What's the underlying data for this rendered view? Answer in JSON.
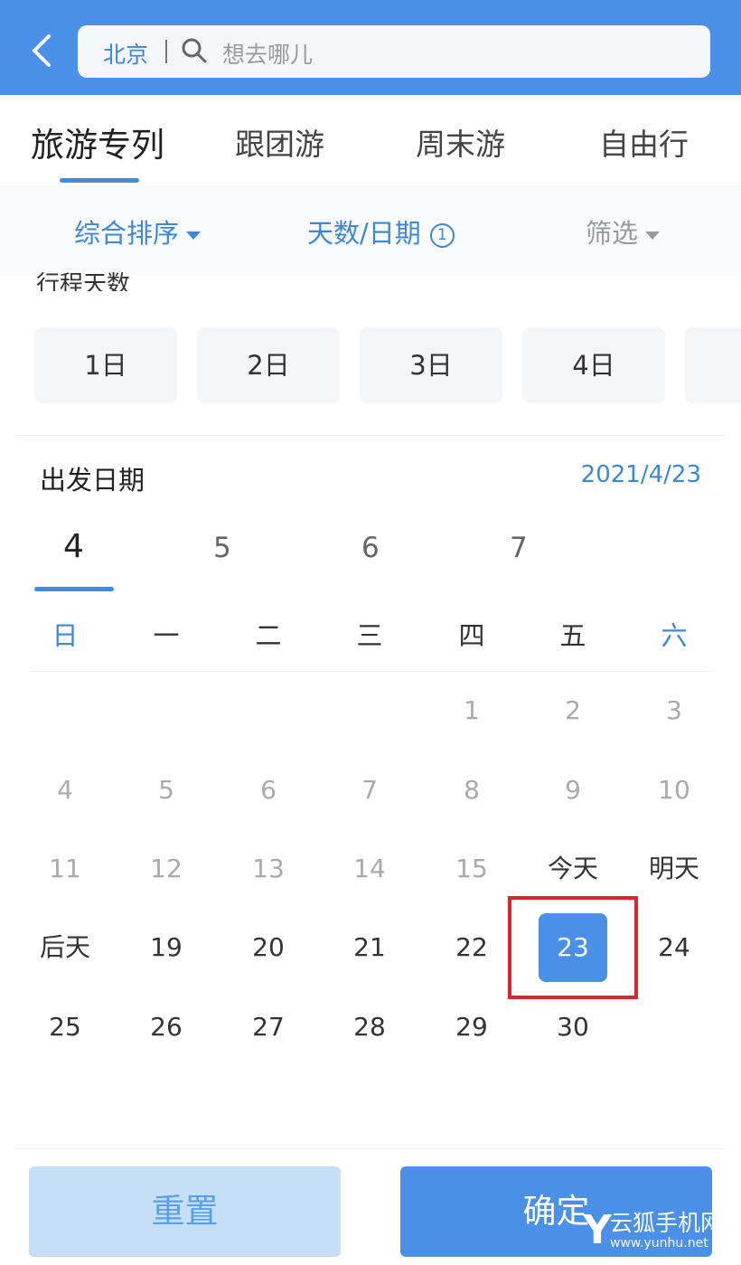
{
  "search": {
    "city": "北京",
    "placeholder": "想去哪儿"
  },
  "tabs": [
    {
      "label": "旅游专列"
    },
    {
      "label": "跟团游"
    },
    {
      "label": "周末游"
    },
    {
      "label": "自由行"
    }
  ],
  "filters": {
    "sort": "综合排序",
    "date": "天数/日期",
    "date_badge": "1",
    "screen": "筛选"
  },
  "days_section": {
    "title": "行程天数",
    "options": [
      "1日",
      "2日",
      "3日",
      "4日"
    ]
  },
  "departure": {
    "title": "出发日期",
    "value": "2021/4/23"
  },
  "months": [
    "4",
    "5",
    "6",
    "7"
  ],
  "weekdays": [
    "日",
    "一",
    "二",
    "三",
    "四",
    "五",
    "六"
  ],
  "calendar": {
    "row1": [
      "1",
      "2",
      "3"
    ],
    "row2": [
      "4",
      "5",
      "6",
      "7",
      "8",
      "9",
      "10"
    ],
    "row3": [
      "11",
      "12",
      "13",
      "14",
      "15",
      "今天",
      "明天"
    ],
    "row4": [
      "后天",
      "19",
      "20",
      "21",
      "22",
      "23",
      "24"
    ],
    "row5": [
      "25",
      "26",
      "27",
      "28",
      "29",
      "30"
    ]
  },
  "buttons": {
    "reset": "重置",
    "confirm": "确定"
  },
  "watermark": {
    "logo": "Y",
    "name": "云狐手机网",
    "url": "www.yunhu.net"
  },
  "colors": {
    "primary": "#4a90e8",
    "highlight": "#d9262c"
  }
}
